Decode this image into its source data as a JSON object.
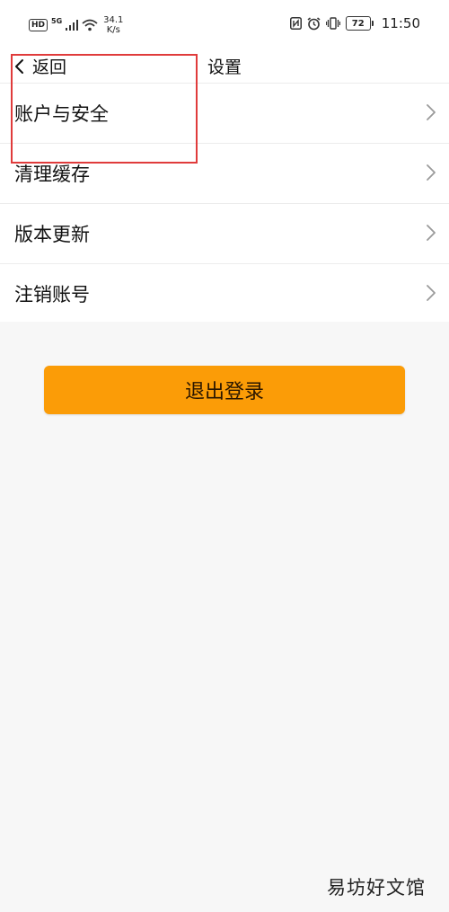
{
  "status_bar": {
    "hd_badge": "HD",
    "network_type": "5G",
    "speed_value": "34.1",
    "speed_unit": "K/s",
    "battery": "72",
    "time": "11:50"
  },
  "nav": {
    "back_label": "返回",
    "title": "设置"
  },
  "settings_items": [
    {
      "label": "账户与安全"
    },
    {
      "label": "清理缓存"
    },
    {
      "label": "版本更新"
    },
    {
      "label": "注销账号"
    }
  ],
  "logout_button": {
    "label": "退出登录"
  },
  "watermark": "易坊好文馆",
  "colors": {
    "accent": "#fb9c07",
    "highlight_box": "#e03b3b",
    "background": "#f7f7f7"
  }
}
